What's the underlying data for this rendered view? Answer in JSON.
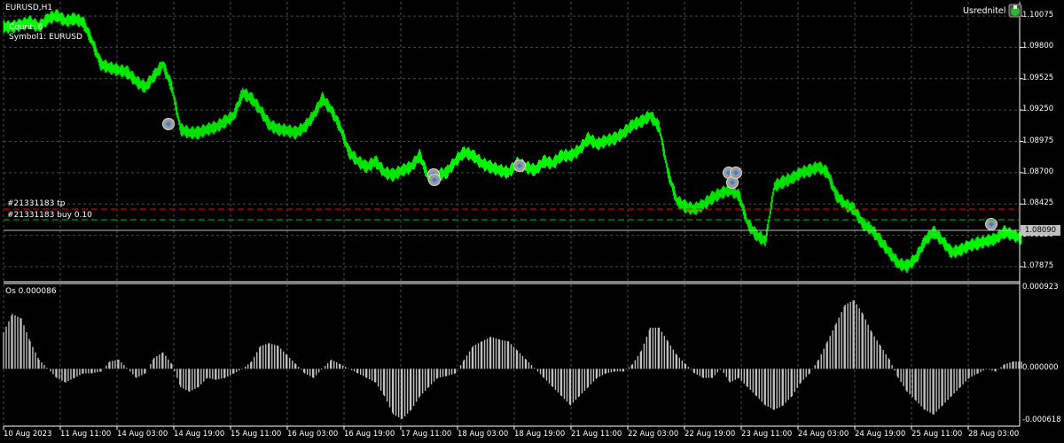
{
  "chart_window": {
    "symbol_title": "EURUSD,H1",
    "overlay_count": "Count: 6",
    "overlay_symbol": "Symbol1: EURUSD",
    "expert_name": "Usrednitel",
    "expert_icon": "smiley-icon",
    "trade_line_tp": "#21331183 tp",
    "trade_line_buy": "#21331183 buy 0.10",
    "current_price_tag": "1.08090",
    "price_axis_labels": [
      "1.10075",
      "1.09800",
      "1.09525",
      "1.09250",
      "1.08975",
      "1.08700",
      "1.08425",
      "1.08150",
      "1.07875"
    ],
    "colors": {
      "background": "#000000",
      "bars": "#00ff00",
      "grid": "#4a4a4a",
      "tp_line": "#ff0000",
      "open_line": "#00c000",
      "histogram": "#c0c0c0"
    }
  },
  "indicator_window": {
    "title": "Os 0.000086",
    "axis_labels": [
      "0.000923",
      "0.000000",
      "-0.000618"
    ]
  },
  "time_axis_labels": [
    "10 Aug 2023",
    "11 Aug 11:00",
    "14 Aug 03:00",
    "14 Aug 19:00",
    "15 Aug 11:00",
    "16 Aug 03:00",
    "16 Aug 19:00",
    "17 Aug 11:00",
    "18 Aug 03:00",
    "18 Aug 19:00",
    "21 Aug 11:00",
    "22 Aug 03:00",
    "22 Aug 19:00",
    "23 Aug 11:00",
    "24 Aug 03:00",
    "24 Aug 19:00",
    "25 Aug 11:00",
    "28 Aug 03:00"
  ],
  "chart_data": [
    {
      "type": "line",
      "ylim": [
        1.0775,
        1.102
      ],
      "y_ticks": [
        1.10075,
        1.098,
        1.09525,
        1.0925,
        1.08975,
        1.087,
        1.08425,
        1.0815,
        1.07875
      ],
      "grid": true,
      "hlines": [
        1.0835,
        1.0822,
        1.0809
      ],
      "x": [
        0,
        10,
        20,
        30,
        40,
        50,
        60,
        70,
        80,
        90,
        100,
        110,
        120,
        130,
        140,
        150,
        160,
        170,
        180,
        190,
        200,
        210,
        220,
        230,
        240,
        250,
        260,
        270,
        280,
        290,
        300,
        310,
        320,
        330,
        340,
        350,
        360,
        370,
        380,
        390,
        400,
        410,
        420,
        430,
        440,
        450,
        460,
        470,
        480,
        490,
        500,
        510,
        520,
        530,
        540,
        550,
        560,
        570,
        580,
        590,
        600,
        610,
        620,
        630,
        640,
        650,
        660,
        670,
        680,
        690,
        700,
        710,
        720,
        730,
        740,
        750,
        760,
        770,
        780,
        790,
        800,
        810,
        820,
        830,
        840,
        850,
        860,
        870,
        880,
        890,
        900,
        910,
        920,
        930,
        940,
        950,
        960,
        970,
        980,
        990,
        1000,
        1010,
        1020,
        1030,
        1040,
        1050,
        1060,
        1070,
        1080,
        1090,
        1100,
        1110,
        1120,
        1130,
        1140
      ],
      "series": [
        {
          "values": [
            1.0998,
            1.1,
            1.1002,
            1.0998,
            1.1005,
            1.1008,
            1.1003,
            1.1005,
            1.1002,
            1.0985,
            1.0965,
            1.0962,
            1.096,
            1.0958,
            1.095,
            1.0945,
            1.0955,
            1.0965,
            1.0945,
            1.0908,
            1.0905,
            1.0905,
            1.0908,
            1.091,
            1.0915,
            1.092,
            1.094,
            1.0935,
            1.0925,
            1.0912,
            1.0908,
            1.0907,
            1.0905,
            1.091,
            1.092,
            1.0935,
            1.0925,
            1.091,
            1.0888,
            1.088,
            1.0875,
            1.088,
            1.087,
            1.0868,
            1.0872,
            1.0875,
            1.0885,
            1.0865,
            1.0868,
            1.087,
            1.088,
            1.0888,
            1.0885,
            1.0878,
            1.0875,
            1.0872,
            1.087,
            1.0878,
            1.0875,
            1.0872,
            1.088,
            1.0878,
            1.0885,
            1.0885,
            1.089,
            1.09,
            1.0895,
            1.0898,
            1.09,
            1.0905,
            1.0912,
            1.0915,
            1.092,
            1.091,
            1.087,
            1.0845,
            1.084,
            1.0838,
            1.0842,
            1.0848,
            1.0852,
            1.0855,
            1.085,
            1.0825,
            1.0815,
            1.081,
            1.0858,
            1.0862,
            1.0865,
            1.087,
            1.0872,
            1.0875,
            1.087,
            1.085,
            1.0842,
            1.0838,
            1.0825,
            1.082,
            1.081,
            1.08,
            1.079,
            1.0788,
            1.0795,
            1.081,
            1.0818,
            1.081,
            1.08,
            1.0802,
            1.0806,
            1.0808,
            1.081,
            1.0812,
            1.0818,
            1.0815,
            1.0812
          ]
        }
      ]
    },
    {
      "type": "bar",
      "ylim": [
        -0.000618,
        0.000923
      ],
      "y_ticks": [
        0.000923,
        0.0,
        -0.000618
      ],
      "x": [
        0,
        10,
        20,
        30,
        40,
        50,
        60,
        70,
        80,
        90,
        100,
        110,
        120,
        130,
        140,
        150,
        160,
        170,
        180,
        190,
        200,
        210,
        220,
        230,
        240,
        250,
        260,
        270,
        280,
        290,
        300,
        310,
        320,
        330,
        340,
        350,
        360,
        370,
        380,
        390,
        400,
        410,
        420,
        430,
        440,
        450,
        460,
        470,
        480,
        490,
        500,
        510,
        520,
        530,
        540,
        550,
        560,
        570,
        580,
        590,
        600,
        610,
        620,
        630,
        640,
        650,
        660,
        670,
        680,
        690,
        700,
        710,
        720,
        730,
        740,
        750,
        760,
        770,
        780,
        790,
        800,
        810,
        820,
        830,
        840,
        850,
        860,
        870,
        880,
        890,
        900,
        910,
        920,
        930,
        940,
        950,
        960,
        970,
        980,
        990,
        1000,
        1010,
        1020,
        1030,
        1040,
        1050,
        1060,
        1070,
        1080,
        1090,
        1100,
        1110,
        1120,
        1130,
        1140
      ],
      "series": [
        {
          "values": [
            0.0004,
            0.0006,
            0.00055,
            0.0003,
            0.0001,
            0.0,
            -0.0001,
            -0.00015,
            -0.0001,
            -5e-05,
            -5e-05,
            -3e-05,
            8e-05,
            0.0001,
            0.0,
            -0.0001,
            -5e-05,
            0.00012,
            0.00018,
            5e-05,
            -0.0002,
            -0.00025,
            -0.0002,
            -0.0001,
            -0.00012,
            -0.0001,
            -5e-05,
            0.0,
            8e-05,
            0.00025,
            0.00028,
            0.00025,
            0.00015,
            5e-05,
            -5e-05,
            -0.0001,
            0.0,
            0.0001,
            5e-05,
            0.0,
            -5e-05,
            -0.0001,
            -0.00015,
            -0.0003,
            -0.0005,
            -0.00055,
            -0.00045,
            -0.0003,
            -0.0002,
            -0.0001,
            -8e-05,
            -5e-05,
            0.0001,
            0.00025,
            0.0003,
            0.00035,
            0.00032,
            0.0003,
            0.0002,
            0.0001,
            0.0,
            -0.0001,
            -0.0002,
            -0.0003,
            -0.0004,
            -0.0003,
            -0.0002,
            -0.0001,
            -5e-05,
            -3e-05,
            -3e-05,
            5e-05,
            0.0002,
            0.00045,
            0.00045,
            0.0003,
            0.00015,
            5e-05,
            -5e-05,
            -0.0001,
            -0.0001,
            0.0,
            -0.00015,
            -0.0001,
            -0.0002,
            -0.0003,
            -0.0004,
            -0.00045,
            -0.0004,
            -0.0003,
            -0.00015,
            -5e-05,
            0.0001,
            0.0003,
            0.0005,
            0.0007,
            0.00075,
            0.0006,
            0.0004,
            0.00025,
            0.0001,
            -0.0001,
            -0.00025,
            -0.00035,
            -0.00045,
            -0.0005,
            -0.0004,
            -0.0003,
            -0.0002,
            -0.0001,
            -5e-05,
            0.0,
            -3e-05,
            5e-05,
            8e-05
          ]
        }
      ]
    }
  ]
}
